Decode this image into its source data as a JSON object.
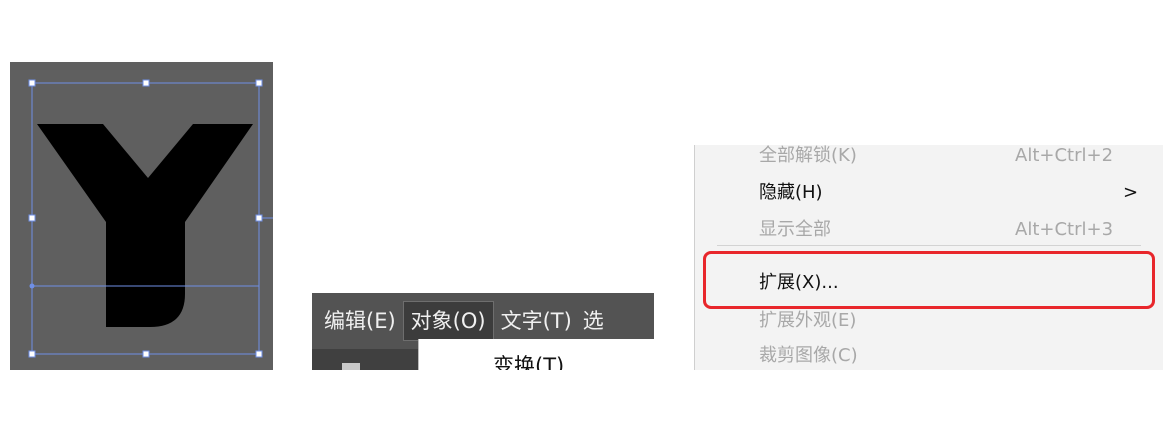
{
  "colors": {
    "canvas_bg": "#5f5f5f",
    "selection": "#6f8fe6",
    "glyph": "#000000",
    "menubar_bg": "#535353",
    "menu_bg": "#f3f3f3",
    "disabled_text": "#a8a8a8",
    "highlight": "#e8262b"
  },
  "canvas": {
    "glyph_icon": "letter-y-shape"
  },
  "menubar": {
    "items": [
      {
        "label": "编辑(E)"
      },
      {
        "label": "对象(O)"
      },
      {
        "label": "文字(T)"
      },
      {
        "label": "选"
      }
    ],
    "active_index": 1,
    "dropdown_first_item": "变换(T)"
  },
  "context_menu": {
    "items": [
      {
        "label": "全部解锁(K)",
        "shortcut": "Alt+Ctrl+2",
        "enabled": false
      },
      {
        "label": "隐藏(H)",
        "submenu": true,
        "enabled": true
      },
      {
        "label": "显示全部",
        "shortcut": "Alt+Ctrl+3",
        "enabled": false
      },
      {
        "label": "扩展(X)...",
        "enabled": true,
        "highlighted": true
      },
      {
        "label": "扩展外观(E)",
        "enabled": false
      },
      {
        "label": "裁剪图像(C)",
        "enabled": false
      }
    ],
    "submenu_arrow": ">"
  }
}
